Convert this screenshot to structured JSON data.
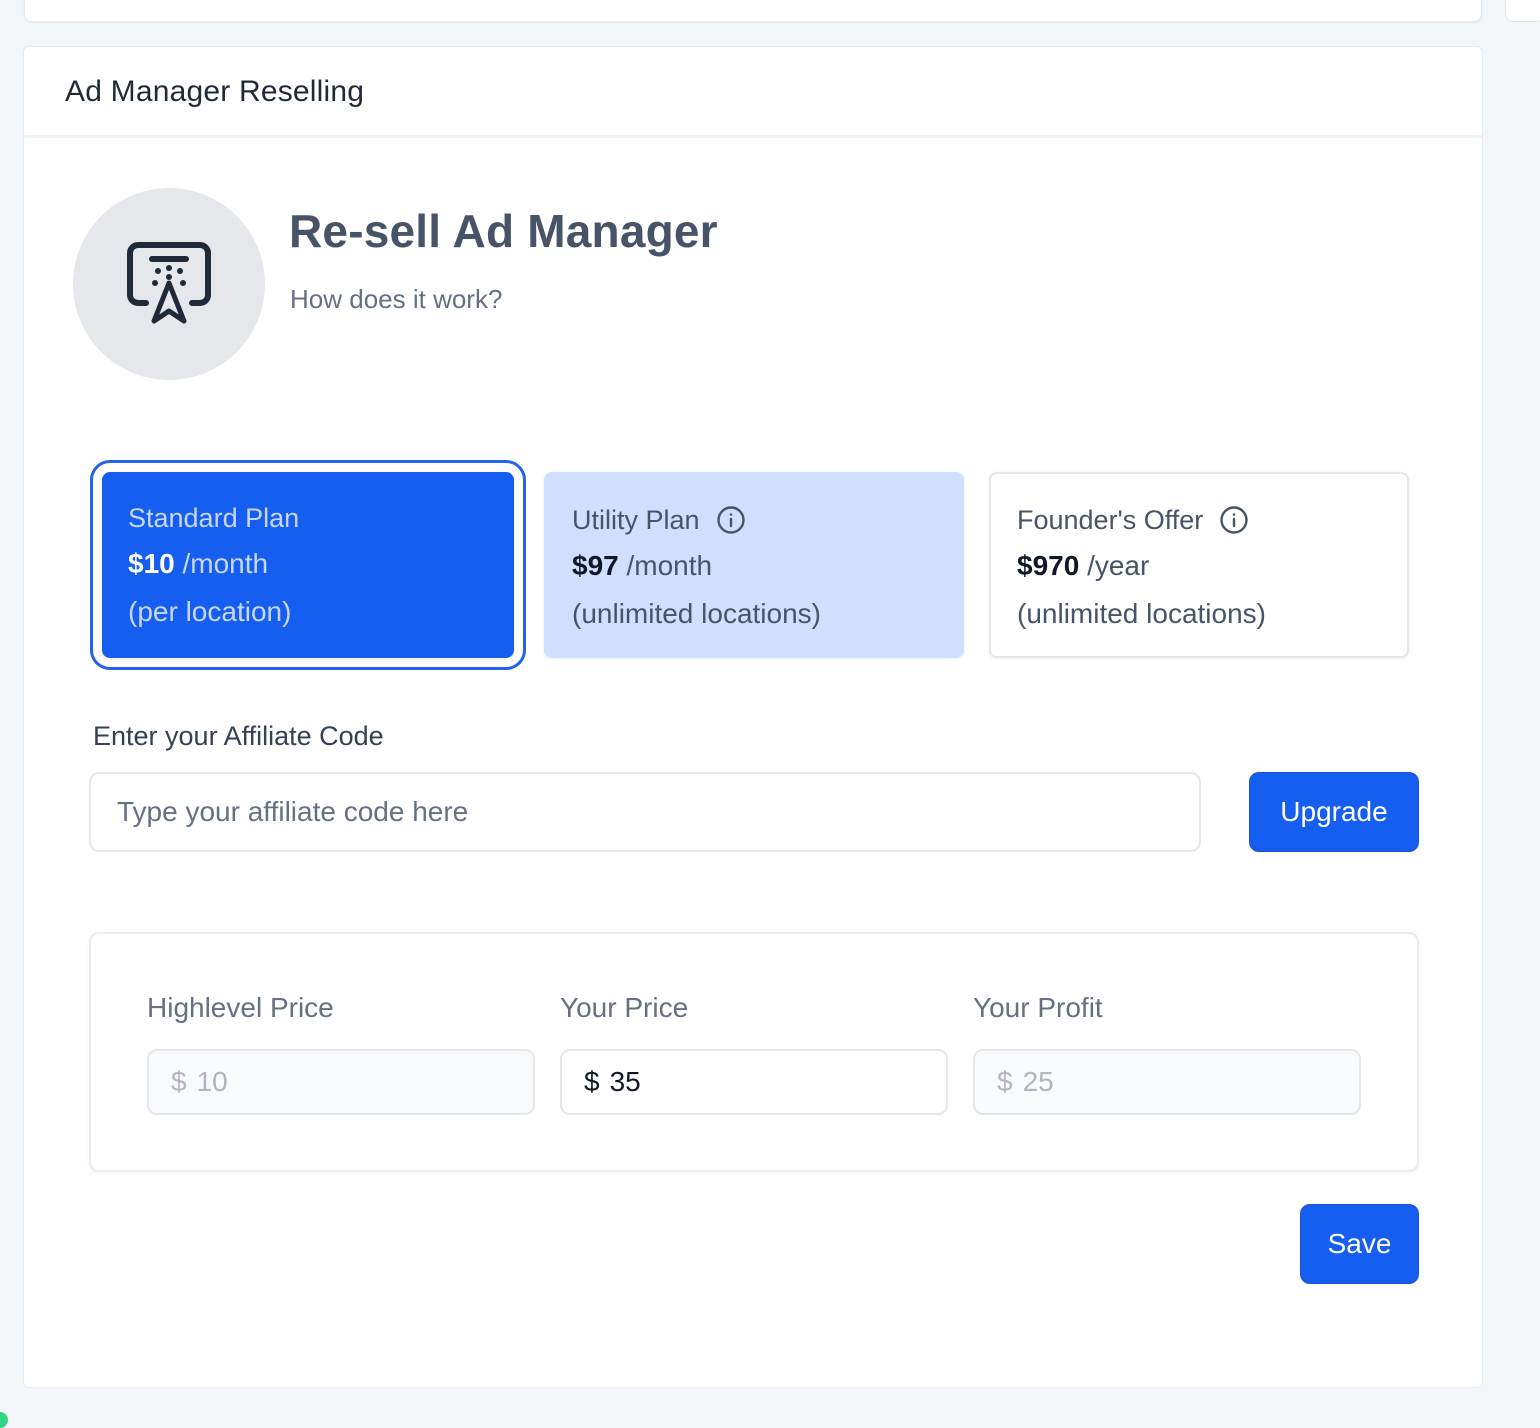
{
  "card": {
    "title": "Ad Manager Reselling"
  },
  "hero": {
    "icon": "ad-manager-icon",
    "title": "Re-sell Ad Manager",
    "subtitle": "How does it work?"
  },
  "plans": [
    {
      "name": "Standard Plan",
      "price": "$10",
      "period": "/month",
      "note": "(per location)",
      "selected": true,
      "info_icon": false
    },
    {
      "name": "Utility Plan",
      "price": "$97",
      "period": "/month",
      "note": "(unlimited locations)",
      "selected": false,
      "info_icon": true
    },
    {
      "name": "Founder's Offer",
      "price": "$970",
      "period": "/year",
      "note": "(unlimited locations)",
      "selected": false,
      "info_icon": true
    }
  ],
  "affiliate": {
    "label": "Enter your Affiliate Code",
    "placeholder": "Type your affiliate code here",
    "value": "",
    "button_label": "Upgrade"
  },
  "pricing": {
    "highlevel": {
      "label": "Highlevel Price",
      "currency": "$",
      "value": "10",
      "disabled": true
    },
    "your_price": {
      "label": "Your Price",
      "currency": "$",
      "value": "35",
      "disabled": false
    },
    "your_profit": {
      "label": "Your Profit",
      "currency": "$",
      "value": "25",
      "disabled": true
    }
  },
  "save_label": "Save",
  "colors": {
    "primary": "#155eef",
    "selected_plan_bg": "#155eef",
    "utility_plan_bg": "#d1dffe",
    "page_bg": "#f3f6f8",
    "avatar_bg": "#e5e7eb"
  }
}
